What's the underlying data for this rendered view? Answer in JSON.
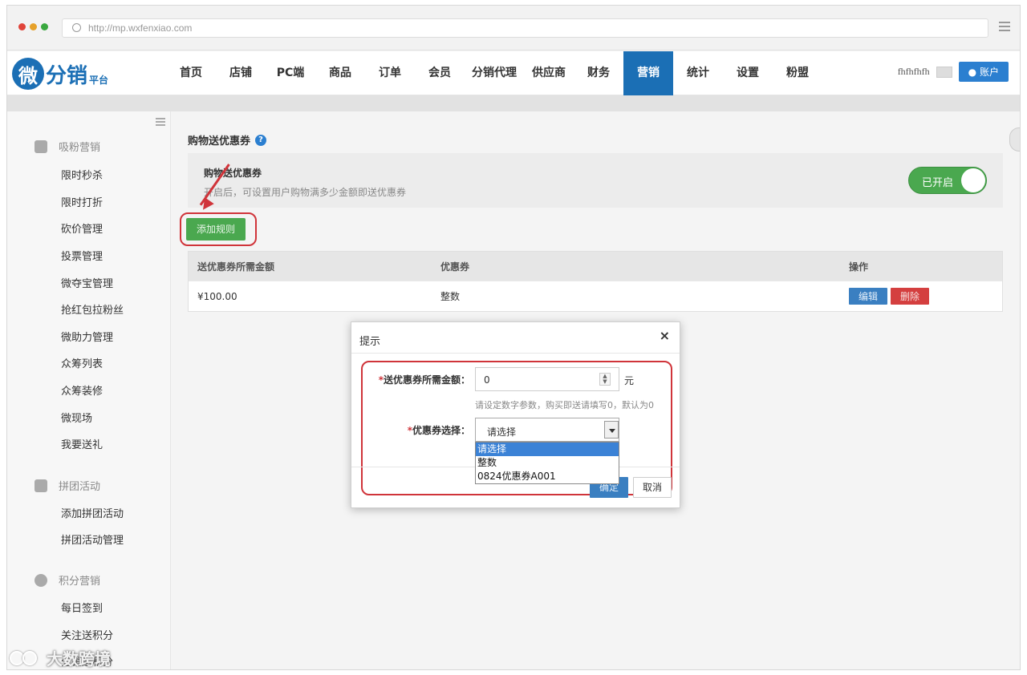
{
  "browser": {
    "url": "http://mp.wxfenxiao.com",
    "dot_colors": [
      "#e0443a",
      "#e6a12a",
      "#3aa83f"
    ]
  },
  "topnav": {
    "logo_char": "微",
    "logo_text": "分销",
    "logo_sub": "平台",
    "items": [
      {
        "label": "首页"
      },
      {
        "label": "店铺"
      },
      {
        "label": "PC端"
      },
      {
        "label": "商品"
      },
      {
        "label": "订单"
      },
      {
        "label": "会员"
      },
      {
        "label": "分销代理"
      },
      {
        "label": "供应商"
      },
      {
        "label": "财务"
      },
      {
        "label": "营销",
        "active": true
      },
      {
        "label": "统计"
      },
      {
        "label": "设置"
      },
      {
        "label": "粉盟"
      }
    ],
    "username": "fhfhfhfh",
    "account_label": "账户"
  },
  "sidebar": {
    "groups": [
      {
        "title": "吸粉营销",
        "icon": "user-plus-icon",
        "items": [
          "限时秒杀",
          "限时打折",
          "砍价管理",
          "投票管理",
          "微夺宝管理",
          "抢红包拉粉丝",
          "微助力管理",
          "众筹列表",
          "众筹装修",
          "微现场",
          "我要送礼"
        ]
      },
      {
        "title": "拼团活动",
        "icon": "grid-icon",
        "items": [
          "添加拼团活动",
          "拼团活动管理"
        ]
      },
      {
        "title": "积分营销",
        "icon": "pie-icon",
        "items": [
          "每日签到",
          "关注送积分",
          "分销送积分"
        ]
      }
    ]
  },
  "main": {
    "title": "购物送优惠券",
    "panel_title": "购物送优惠券",
    "panel_desc": "开启后，可设置用户购物满多少金额即送优惠券",
    "toggle_label": "已开启",
    "add_rule_label": "添加规则",
    "table": {
      "headers": [
        "送优惠券所需金额",
        "优惠券",
        "操作"
      ],
      "rows": [
        {
          "amount": "¥100.00",
          "coupon": "整数",
          "edit": "编辑",
          "delete": "删除"
        }
      ]
    }
  },
  "dialog": {
    "title": "提示",
    "close": "×",
    "amount_label": "送优惠券所需金额：",
    "amount_value": "0",
    "amount_unit": "元",
    "amount_hint": "请设定数字参数，购买即送请填写0，默认为0",
    "coupon_label": "优惠券选择：",
    "required_mark": "*",
    "select_value": "请选择",
    "options": [
      "请选择",
      "整数",
      "0824优惠券A001"
    ],
    "ok_label": "确定",
    "cancel_label": "取消"
  },
  "watermark": {
    "text": "大数跨境"
  }
}
